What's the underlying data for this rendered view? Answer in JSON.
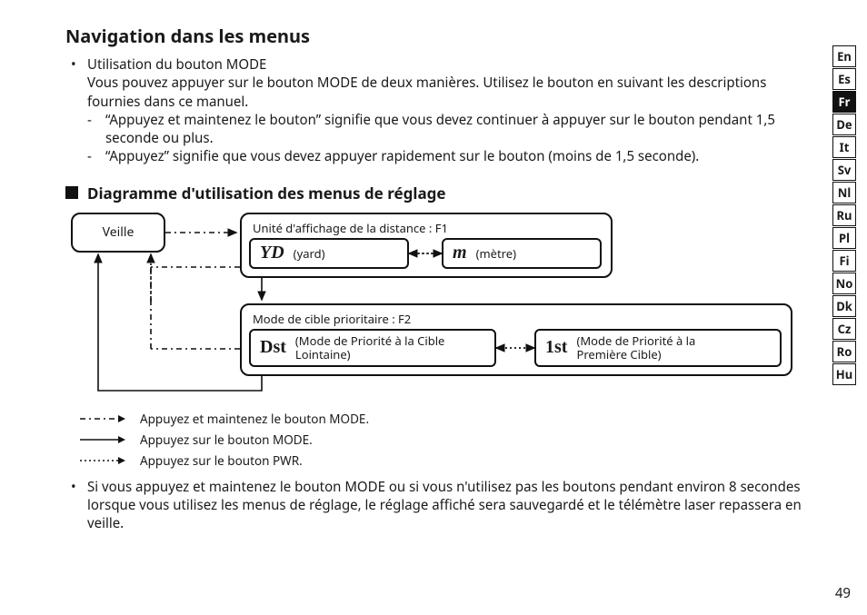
{
  "page_number": "49",
  "title": "Navigation dans les menus",
  "bullet1_label": "Utilisation du bouton MODE",
  "bullet1_text": "Vous pouvez appuyer sur le bouton MODE de deux manières. Utilisez le bouton en suivant les descriptions fournies dans ce manuel.",
  "bullet1_dash1": "“Appuyez et maintenez le bouton” signifie que vous devez continuer à appuyer sur le bouton pendant 1,5 seconde ou plus.",
  "bullet1_dash2": "“Appuyez” signifie que vous devez appuyer rapidement sur le bouton (moins de 1,5 seconde).",
  "diagram_heading": "Diagramme d'utilisation des menus de réglage",
  "standby_label": "Veille",
  "f1_title": "Unité d'affichage de la distance : F1",
  "yd_key": "YD",
  "yd_val": "(yard)",
  "m_key": "m",
  "m_val": "(mètre)",
  "f2_title": "Mode de cible prioritaire : F2",
  "dst_key": "Dst",
  "dst_val": "(Mode de Priorité à la Cible Lointaine)",
  "first_key": "1st",
  "first_val": "(Mode de Priorité à la Première Cible)",
  "legend_hold": "Appuyez et maintenez le bouton MODE.",
  "legend_press_mode": "Appuyez sur le bouton MODE.",
  "legend_press_pwr": "Appuyez sur le bouton PWR.",
  "note_text": "Si vous appuyez et maintenez le bouton MODE ou si vous n'utilisez pas les boutons pendant environ 8 secondes lorsque vous utilisez les menus de réglage, le réglage affiché sera sauvegardé et le télémètre laser repassera en veille.",
  "languages": [
    "En",
    "Es",
    "Fr",
    "De",
    "It",
    "Sv",
    "Nl",
    "Ru",
    "Pl",
    "Fi",
    "No",
    "Dk",
    "Cz",
    "Ro",
    "Hu"
  ],
  "active_language": "Fr"
}
